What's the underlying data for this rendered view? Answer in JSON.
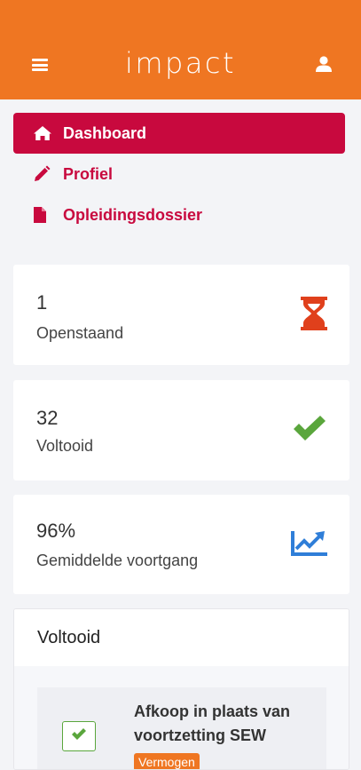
{
  "header": {
    "logo_text": "impact",
    "menu_icon": "hamburger-icon",
    "user_icon": "user-icon",
    "bg_color": "#ef7622"
  },
  "nav": {
    "items": [
      {
        "label": "Dashboard",
        "icon": "home-icon",
        "active": true
      },
      {
        "label": "Profiel",
        "icon": "pencil-icon",
        "active": false
      },
      {
        "label": "Opleidingsdossier",
        "icon": "file-icon",
        "active": false
      }
    ],
    "accent_color": "#c8093e"
  },
  "stats": [
    {
      "value": "1",
      "label": "Openstaand",
      "icon": "hourglass-icon",
      "icon_color": "#e0401c"
    },
    {
      "value": "32",
      "label": "Voltooid",
      "icon": "checkmark-icon",
      "icon_color": "#5aa63c"
    },
    {
      "value": "96%",
      "label": "Gemiddelde voortgang",
      "icon": "trend-chart-icon",
      "icon_color": "#2f7ed8"
    }
  ],
  "completed_panel": {
    "title": "Voltooid",
    "tasks": [
      {
        "title": "Afkoop in plaats van voortzetting SEW",
        "tag": "Vermogen",
        "checked": true
      }
    ]
  }
}
